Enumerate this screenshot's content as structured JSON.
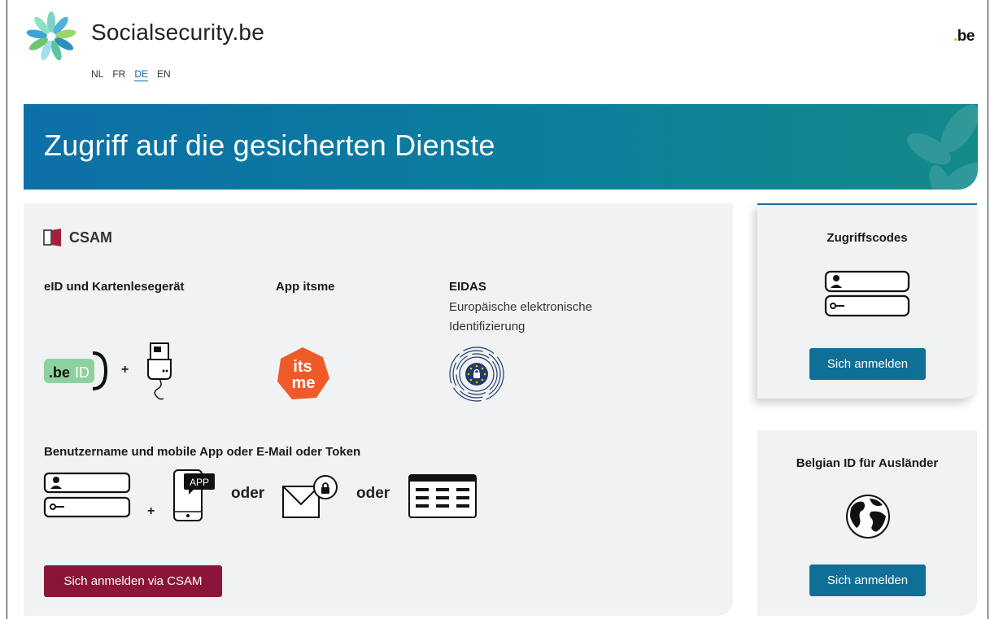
{
  "header": {
    "site_title": "Socialsecurity.be",
    "languages": [
      "NL",
      "FR",
      "DE",
      "EN"
    ],
    "active_language": "DE",
    "gov_logo": "be",
    "gov_logo_dot": "."
  },
  "banner": {
    "title": "Zugriff auf die gesicherten Dienste"
  },
  "csam": {
    "logo_text": "CSAM",
    "methods": [
      {
        "title": "eID und Kartenlesegerät",
        "subtitle": ""
      },
      {
        "title": "App itsme",
        "subtitle": ""
      },
      {
        "title": "EIDAS",
        "subtitle": "Europäische elektronische Identifizierung"
      }
    ],
    "beid_label_be": ".be",
    "beid_label_id": "ID",
    "plus": "+",
    "itsme_top": "its",
    "itsme_bottom": "me",
    "username_title": "Benutzername und mobile App oder E-Mail oder Token",
    "app_badge": "APP",
    "or_word": "oder",
    "login_button": "Sich anmelden via CSAM"
  },
  "cards": [
    {
      "title": "Zugriffscodes",
      "button": "Sich anmelden",
      "icon": "credentials-icon"
    },
    {
      "title": "Belgian ID für Ausländer",
      "button": "Sich anmelden",
      "icon": "globe-icon"
    }
  ],
  "colors": {
    "banner_start": "#0d6fa8",
    "banner_end": "#138a8a",
    "csam_button": "#8b1538",
    "card_button": "#0f6f96",
    "itsme": "#f05a28",
    "beid_green": "#8fd19e"
  }
}
